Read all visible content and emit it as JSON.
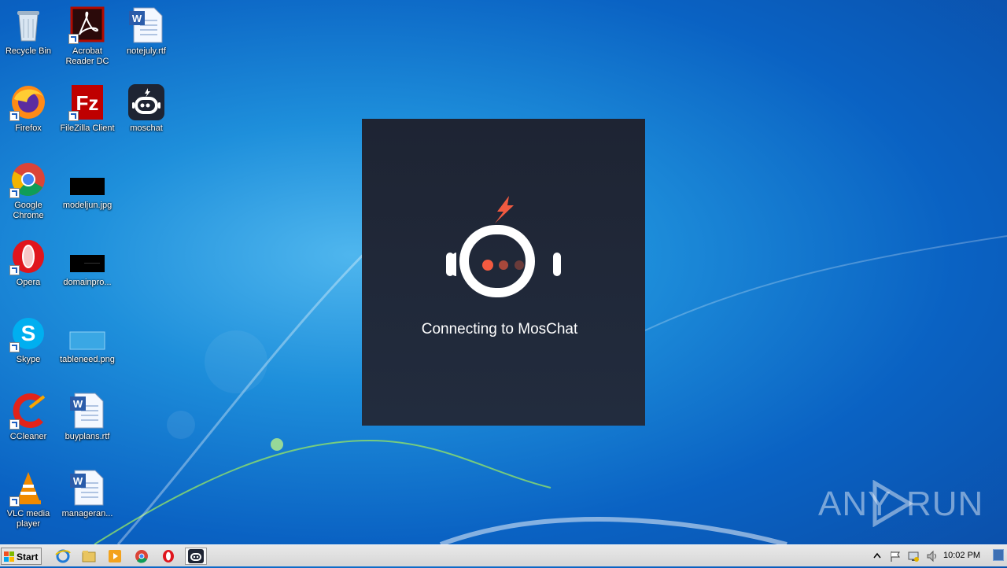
{
  "desktop_icons": {
    "recycle_bin": "Recycle Bin",
    "acrobat": "Acrobat Reader DC",
    "notejuly": "notejuly.rtf",
    "firefox": "Firefox",
    "filezilla": "FileZilla Client",
    "moschat": "moschat",
    "chrome": "Google Chrome",
    "modeljun": "modeljun.jpg",
    "opera": "Opera",
    "domainpro": "domainpro...",
    "skype": "Skype",
    "tableneed": "tableneed.png",
    "ccleaner": "CCleaner",
    "buyplans": "buyplans.rtf",
    "vlc": "VLC media player",
    "manageran": "manageran..."
  },
  "splash": {
    "message": "Connecting to MosChat"
  },
  "watermark": {
    "left": "ANY",
    "right": "RUN"
  },
  "taskbar": {
    "start_label": "Start",
    "clock": "10:02 PM"
  },
  "colors": {
    "splash_bg": "#1e2433",
    "accent": "#f25a40"
  }
}
